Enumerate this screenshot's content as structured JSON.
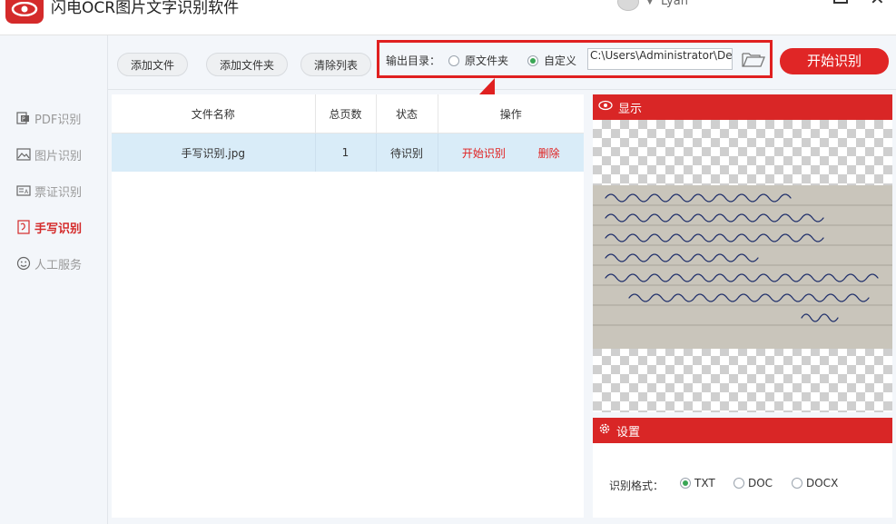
{
  "app": {
    "title": "闪电OCR图片文字识别软件",
    "user": "Lyan"
  },
  "sidebar": {
    "items": [
      {
        "label": "PDF识别",
        "icon": "pdf-icon"
      },
      {
        "label": "图片识别",
        "icon": "image-icon"
      },
      {
        "label": "票证识别",
        "icon": "ticket-icon"
      },
      {
        "label": "手写识别",
        "icon": "handwriting-icon",
        "active": true
      },
      {
        "label": "人工服务",
        "icon": "smile-icon"
      }
    ]
  },
  "toolbar": {
    "add_file": "添加文件",
    "add_folder": "添加文件夹",
    "clear_list": "清除列表",
    "output_label": "输出目录：",
    "opt_source": "原文件夹",
    "opt_custom": "自定义",
    "path": "C:\\Users\\Administrator\\De",
    "start": "开始识别"
  },
  "table": {
    "headers": [
      "文件名称",
      "总页数",
      "状态",
      "操作"
    ],
    "rows": [
      {
        "name": "手写识别.jpg",
        "pages": "1",
        "status": "待识别",
        "op_start": "开始识别",
        "op_delete": "删除"
      }
    ]
  },
  "preview": {
    "title": "显示"
  },
  "settings": {
    "title": "设置",
    "format_label": "识别格式：",
    "formats": [
      "TXT",
      "DOC",
      "DOCX"
    ],
    "selected_format": "TXT"
  },
  "colors": {
    "accent": "#d92626",
    "selected_row": "#d9ecf8",
    "radio_checked": "#3aa655"
  }
}
